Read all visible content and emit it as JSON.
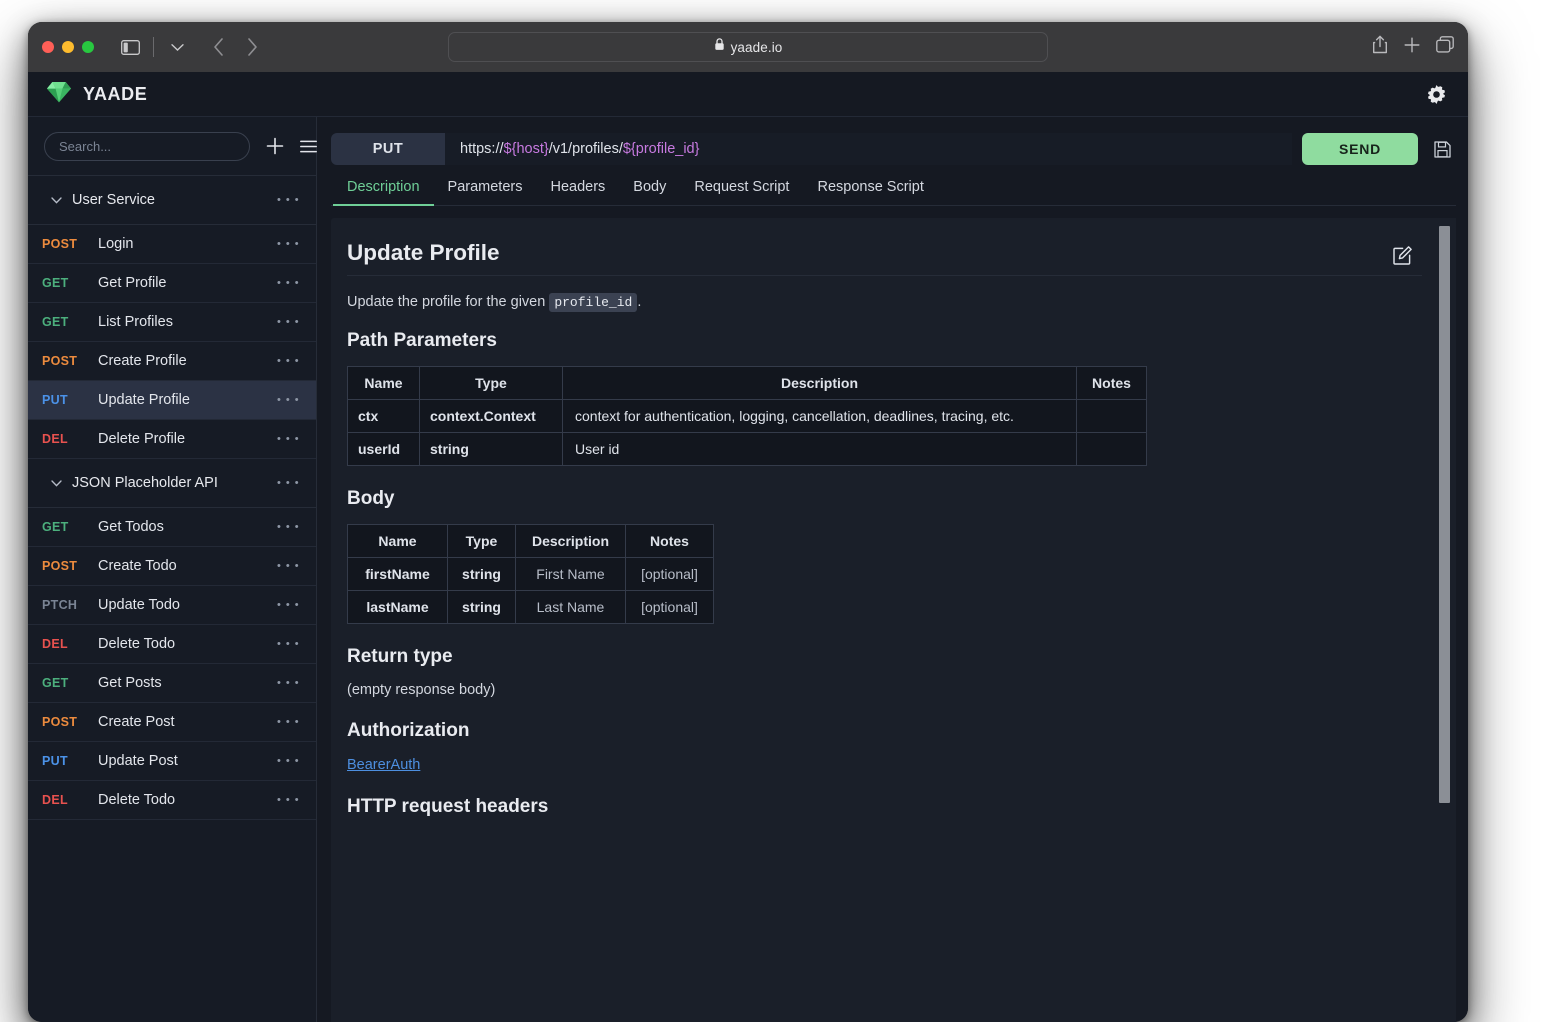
{
  "browser": {
    "url": "yaade.io",
    "lock_icon": "lock-icon",
    "sidebar_toggle_icon": "sidebar-toggle-icon",
    "chevron_down_icon": "chevron-down-icon",
    "back_icon": "back-arrow-icon",
    "forward_icon": "forward-arrow-icon",
    "share_icon": "share-icon",
    "new_tab_icon": "plus-icon",
    "tabs_overview_icon": "tabs-overview-icon"
  },
  "app": {
    "brand": "YAADE",
    "logo_icon": "diamond-gem-icon",
    "settings_icon": "gear-icon"
  },
  "sidebar": {
    "search_placeholder": "Search...",
    "search_value": "",
    "add_icon": "plus-icon",
    "menu_icon": "hamburger-menu-icon",
    "collections": [
      {
        "name": "User Service",
        "expanded": true,
        "requests": [
          {
            "method": "POST",
            "name": "Login",
            "selected": false
          },
          {
            "method": "GET",
            "name": "Get Profile",
            "selected": false
          },
          {
            "method": "GET",
            "name": "List Profiles",
            "selected": false
          },
          {
            "method": "POST",
            "name": "Create Profile",
            "selected": false
          },
          {
            "method": "PUT",
            "name": "Update Profile",
            "selected": true
          },
          {
            "method": "DEL",
            "name": "Delete Profile",
            "selected": false
          }
        ]
      },
      {
        "name": "JSON Placeholder API",
        "expanded": true,
        "requests": [
          {
            "method": "GET",
            "name": "Get Todos",
            "selected": false
          },
          {
            "method": "POST",
            "name": "Create Todo",
            "selected": false
          },
          {
            "method": "PTCH",
            "name": "Update Todo",
            "selected": false
          },
          {
            "method": "DEL",
            "name": "Delete Todo",
            "selected": false
          },
          {
            "method": "GET",
            "name": "Get Posts",
            "selected": false
          },
          {
            "method": "POST",
            "name": "Create Post",
            "selected": false
          },
          {
            "method": "PUT",
            "name": "Update Post",
            "selected": false
          },
          {
            "method": "DEL",
            "name": "Delete Todo",
            "selected": false
          }
        ]
      }
    ]
  },
  "request": {
    "method": "PUT",
    "url_parts": [
      {
        "text": "https://",
        "variable": false
      },
      {
        "text": "${host}",
        "variable": true
      },
      {
        "text": "/v1/profiles/",
        "variable": false
      },
      {
        "text": "${profile_id}",
        "variable": true
      }
    ],
    "url_full": "https://${host}/v1/profiles/${profile_id}",
    "send_label": "SEND",
    "save_icon": "floppy-disk-save-icon",
    "tabs": [
      {
        "label": "Description",
        "active": true
      },
      {
        "label": "Parameters",
        "active": false
      },
      {
        "label": "Headers",
        "active": false
      },
      {
        "label": "Body",
        "active": false
      },
      {
        "label": "Request Script",
        "active": false
      },
      {
        "label": "Response Script",
        "active": false
      }
    ]
  },
  "description": {
    "edit_icon": "edit-pencil-square-icon",
    "title": "Update Profile",
    "intro_before": "Update the profile for the given ",
    "intro_code": "profile_id",
    "intro_after": ".",
    "path_parameters": {
      "heading": "Path Parameters",
      "columns": [
        "Name",
        "Type",
        "Description",
        "Notes"
      ],
      "rows": [
        {
          "name": "ctx",
          "type": "context.Context",
          "description": "context for authentication, logging, cancellation, deadlines, tracing, etc.",
          "notes": ""
        },
        {
          "name": "userId",
          "type": "string",
          "description": "User id",
          "notes": ""
        }
      ]
    },
    "body": {
      "heading": "Body",
      "columns": [
        "Name",
        "Type",
        "Description",
        "Notes"
      ],
      "rows": [
        {
          "name": "firstName",
          "type": "string",
          "description": "First Name",
          "notes": "[optional]"
        },
        {
          "name": "lastName",
          "type": "string",
          "description": "Last Name",
          "notes": "[optional]"
        }
      ]
    },
    "return_type": {
      "heading": "Return type",
      "text": "(empty response body)"
    },
    "authorization": {
      "heading": "Authorization",
      "link": "BearerAuth"
    },
    "http_headers": {
      "heading": "HTTP request headers"
    }
  },
  "colors": {
    "accent_green": "#8fdc9f",
    "tab_active": "#6fcf97",
    "method_post": "#ec8b3e",
    "method_get": "#4caf7d",
    "method_put": "#4b92e8",
    "method_del": "#e8524f",
    "method_ptch": "#7a8494",
    "variable": "#c77ae0",
    "link": "#4d8fe0",
    "bg_app": "#151922",
    "bg_sidebar": "#161b25",
    "bg_card": "#1a1f29"
  }
}
